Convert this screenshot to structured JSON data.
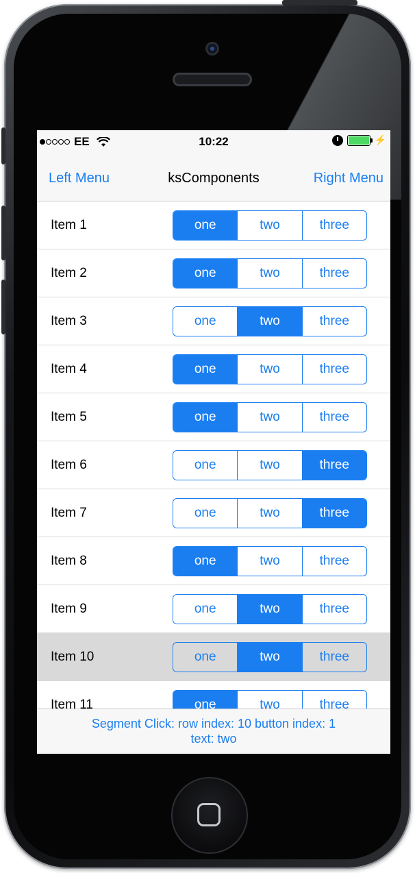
{
  "status": {
    "signal_dots": [
      true,
      false,
      false,
      false,
      false
    ],
    "carrier": "EE",
    "time": "10:22",
    "battery_color": "#4cd964"
  },
  "navbar": {
    "left": "Left Menu",
    "title": "ksComponents",
    "right": "Right Menu"
  },
  "rows": [
    {
      "label": "Item 1",
      "segments": [
        "one",
        "two",
        "three"
      ],
      "selected_index": 0
    },
    {
      "label": "Item 2",
      "segments": [
        "one",
        "two",
        "three"
      ],
      "selected_index": 0
    },
    {
      "label": "Item 3",
      "segments": [
        "one",
        "two",
        "three"
      ],
      "selected_index": 1
    },
    {
      "label": "Item 4",
      "segments": [
        "one",
        "two",
        "three"
      ],
      "selected_index": 0
    },
    {
      "label": "Item 5",
      "segments": [
        "one",
        "two",
        "three"
      ],
      "selected_index": 0
    },
    {
      "label": "Item 6",
      "segments": [
        "one",
        "two",
        "three"
      ],
      "selected_index": 2
    },
    {
      "label": "Item 7",
      "segments": [
        "one",
        "two",
        "three"
      ],
      "selected_index": 2
    },
    {
      "label": "Item 8",
      "segments": [
        "one",
        "two",
        "three"
      ],
      "selected_index": 0
    },
    {
      "label": "Item 9",
      "segments": [
        "one",
        "two",
        "three"
      ],
      "selected_index": 1
    },
    {
      "label": "Item 10",
      "segments": [
        "one",
        "two",
        "three"
      ],
      "selected_index": 1,
      "highlighted": true
    },
    {
      "label": "Item 11",
      "segments": [
        "one",
        "two",
        "three"
      ],
      "selected_index": 0
    }
  ],
  "footer": {
    "line1": "Segment Click: row index: 10   button index: 1",
    "line2": "text: two"
  },
  "colors": {
    "accent": "#1a7ef0",
    "row_highlight": "#d9d9d9"
  },
  "icons": [
    "wifi-icon",
    "alarm-icon",
    "battery-icon",
    "charging-bolt-icon",
    "home-button-icon"
  ]
}
